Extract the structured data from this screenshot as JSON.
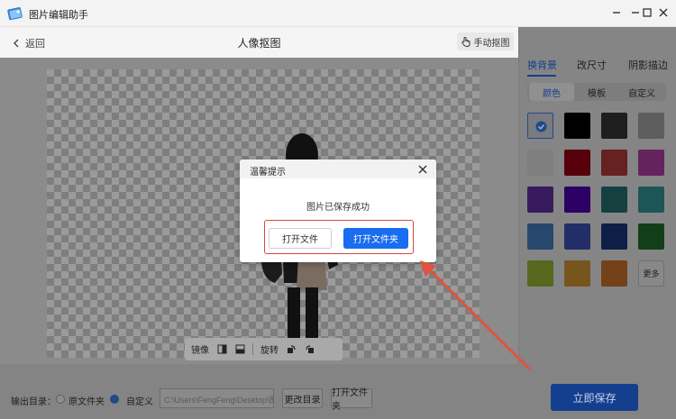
{
  "window": {
    "title": "图片编辑助手",
    "minimize_icon": "minimize-icon",
    "maximize_icon": "maximize-icon",
    "close_icon": "close-icon"
  },
  "header": {
    "back_label": "返回",
    "page_title": "人像抠图",
    "manual_label": "手动抠图"
  },
  "toolbar": {
    "mirror_label": "镜像",
    "rotate_label": "旋转"
  },
  "bottom": {
    "output_label": "输出目录：",
    "option_original": "原文件夹",
    "option_custom": "自定义",
    "path_value": "C:\\Users\\FengFeng\\Desktop\\图片",
    "change_dir_label": "更改目录",
    "open_folder_label": "打开文件夹",
    "save_label": "立即保存"
  },
  "right_panel": {
    "tabs": [
      "换背景",
      "改尺寸",
      "阴影描边"
    ],
    "subtabs": [
      "颜色",
      "模板",
      "自定义"
    ],
    "more_label": "更多",
    "swatch_colors": [
      "#e8ecf7",
      "#000000",
      "#3a3a3a",
      "#b3b3b3",
      "#f2f2f2",
      "#a40016",
      "#c53f3f",
      "#c244b4",
      "#6b33b5",
      "#5500c0",
      "#2b7b7b",
      "#38a6a6",
      "#4b8bd1",
      "#4457c8",
      "#1a3b88",
      "#247a2e",
      "#a8c63a",
      "#e2a43a",
      "#e07d2e"
    ]
  },
  "modal": {
    "title": "温馨提示",
    "message": "图片已保存成功",
    "open_file_label": "打开文件",
    "open_folder_label": "打开文件夹"
  },
  "colors": {
    "accent": "#1a6cf0",
    "highlight": "#d9473a"
  }
}
